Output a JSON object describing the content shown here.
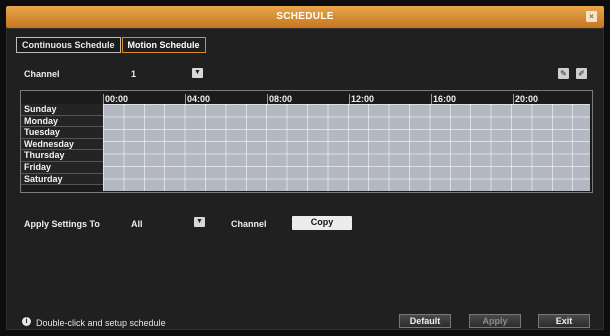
{
  "window": {
    "title": "SCHEDULE",
    "close_glyph": "×"
  },
  "tabs": [
    {
      "label": "Continuous Schedule",
      "active": false
    },
    {
      "label": "Motion Schedule",
      "active": true
    }
  ],
  "channel": {
    "label": "Channel",
    "value": "1"
  },
  "toolbar": {
    "edit_glyph": "✎",
    "erase_glyph": "✐"
  },
  "schedule": {
    "hours": [
      "00:00",
      "04:00",
      "08:00",
      "12:00",
      "16:00",
      "20:00"
    ],
    "days": [
      "Sunday",
      "Monday",
      "Tuesday",
      "Wednesday",
      "Thursday",
      "Friday",
      "Saturday"
    ]
  },
  "apply": {
    "label": "Apply Settings To",
    "value": "All",
    "channel_label": "Channel",
    "copy_label": "Copy"
  },
  "footer": {
    "hint": "Double-click and setup schedule",
    "default_label": "Default",
    "apply_label": "Apply",
    "exit_label": "Exit"
  },
  "colors": {
    "accent": "#d9892a",
    "grid": "#b3b8c2"
  }
}
